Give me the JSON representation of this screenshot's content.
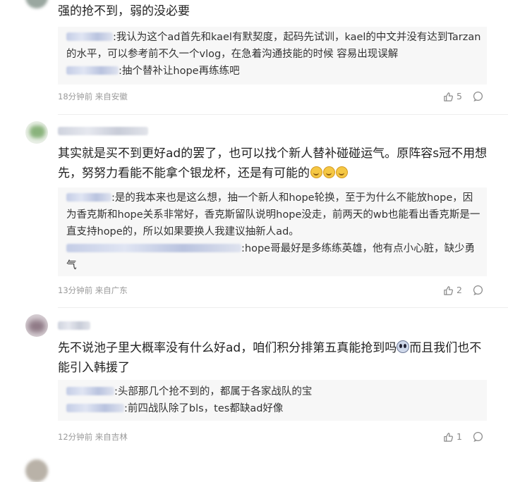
{
  "comments": [
    {
      "text": "强的抢不到，弱的没必要",
      "replies": [
        {
          "text": ":我认为这个ad首先和kael有默契度，起码先试训，kael的中文并没有达到Tarzan的水平，可以参考前不久一个vlog，在急着沟通技能的时候 容易出现误解"
        },
        {
          "text": ":抽个替补让hope再练练吧"
        }
      ],
      "time": "18分钟前",
      "location": "来自安徽",
      "likes": "5"
    },
    {
      "text": "其实就是买不到更好ad的罢了，也可以找个新人替补碰碰运气。原阵容s冠不用想先，努努力看能不能拿个银龙杯，还是有可能的",
      "emojis": [
        "laugh",
        "laugh",
        "laugh"
      ],
      "replies": [
        {
          "text": ":是的我本来也是这么想，抽一个新人和hope轮换，至于为什么不能放hope，因为香克斯和hope关系非常好，香克斯留队说明hope没走，前两天的wb也能看出香克斯是一直支持hope的，所以如果要换人我建议抽新人ad。"
        },
        {
          "text": ":hope哥最好是多练练英雄，他有点小心脏，缺少勇气"
        }
      ],
      "time": "13分钟前",
      "location": "来自广东",
      "likes": "2"
    },
    {
      "text_a": "先不说池子里大概率没有什么好ad，咱们积分排第五真能抢到吗",
      "text_b": "而且我们也不能引入韩援了",
      "replies": [
        {
          "text": ":头部那几个抢不到的，都属于各家战队的宝"
        },
        {
          "text": ":前四战队除了bls，tes都缺ad好像"
        }
      ],
      "time": "12分钟前",
      "location": "来自吉林",
      "likes": "1"
    }
  ],
  "icons": {
    "like": "thumbs-up-icon",
    "comment": "comment-bubble-icon"
  },
  "colors": {
    "meta": "#9a9a9a",
    "reply_bg": "#f7f7f7",
    "text": "#222222"
  }
}
